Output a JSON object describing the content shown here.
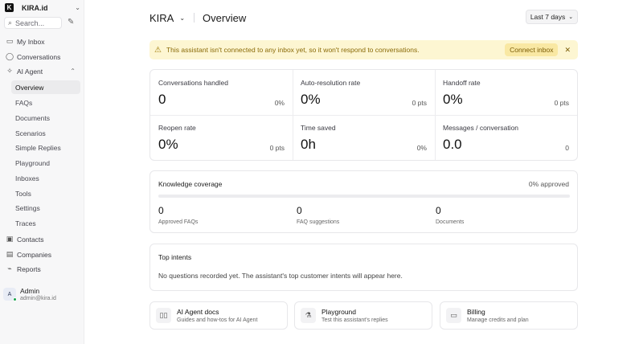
{
  "workspace": {
    "name": "KIRA.id",
    "logo_letter": "K"
  },
  "search": {
    "placeholder": "Search..."
  },
  "nav": {
    "my_inbox": "My Inbox",
    "conversations": "Conversations",
    "ai_agent": "AI Agent",
    "ai_agent_items": [
      "Overview",
      "FAQs",
      "Documents",
      "Scenarios",
      "Simple Replies",
      "Playground",
      "Inboxes",
      "Tools",
      "Settings",
      "Traces"
    ],
    "contacts": "Contacts",
    "companies": "Companies",
    "reports": "Reports"
  },
  "user": {
    "initial": "A",
    "name": "Admin",
    "email": "admin@kira.id"
  },
  "header": {
    "brand": "KIRA",
    "title": "Overview",
    "range": "Last 7 days"
  },
  "alert": {
    "text": "This assistant isn't connected to any inbox yet, so it won't respond to conversations.",
    "action": "Connect inbox"
  },
  "metrics": [
    {
      "label": "Conversations handled",
      "value": "0",
      "delta": "0%"
    },
    {
      "label": "Auto-resolution rate",
      "value": "0%",
      "delta": "0 pts"
    },
    {
      "label": "Handoff rate",
      "value": "0%",
      "delta": "0 pts"
    },
    {
      "label": "Reopen rate",
      "value": "0%",
      "delta": "0 pts"
    },
    {
      "label": "Time saved",
      "value": "0h",
      "delta": "0%"
    },
    {
      "label": "Messages / conversation",
      "value": "0.0",
      "delta": "0"
    }
  ],
  "knowledge": {
    "title": "Knowledge coverage",
    "approved_pct": "0% approved",
    "coverage_fraction": 0,
    "stats": [
      {
        "value": "0",
        "label": "Approved FAQs"
      },
      {
        "value": "0",
        "label": "FAQ suggestions"
      },
      {
        "value": "0",
        "label": "Documents"
      }
    ]
  },
  "top_intents": {
    "title": "Top intents",
    "empty": "No questions recorded yet. The assistant's top customer intents will appear here."
  },
  "cards": [
    {
      "title": "AI Agent docs",
      "subtitle": "Guides and how-tos for AI Agent",
      "icon": "book-icon"
    },
    {
      "title": "Playground",
      "subtitle": "Test this assistant's replies",
      "icon": "flask-icon"
    },
    {
      "title": "Billing",
      "subtitle": "Manage credits and plan",
      "icon": "card-icon"
    }
  ],
  "colors": {
    "alert_bg": "#fdf6d2",
    "alert_text": "#8a6a07",
    "status_online": "#16a34a"
  }
}
